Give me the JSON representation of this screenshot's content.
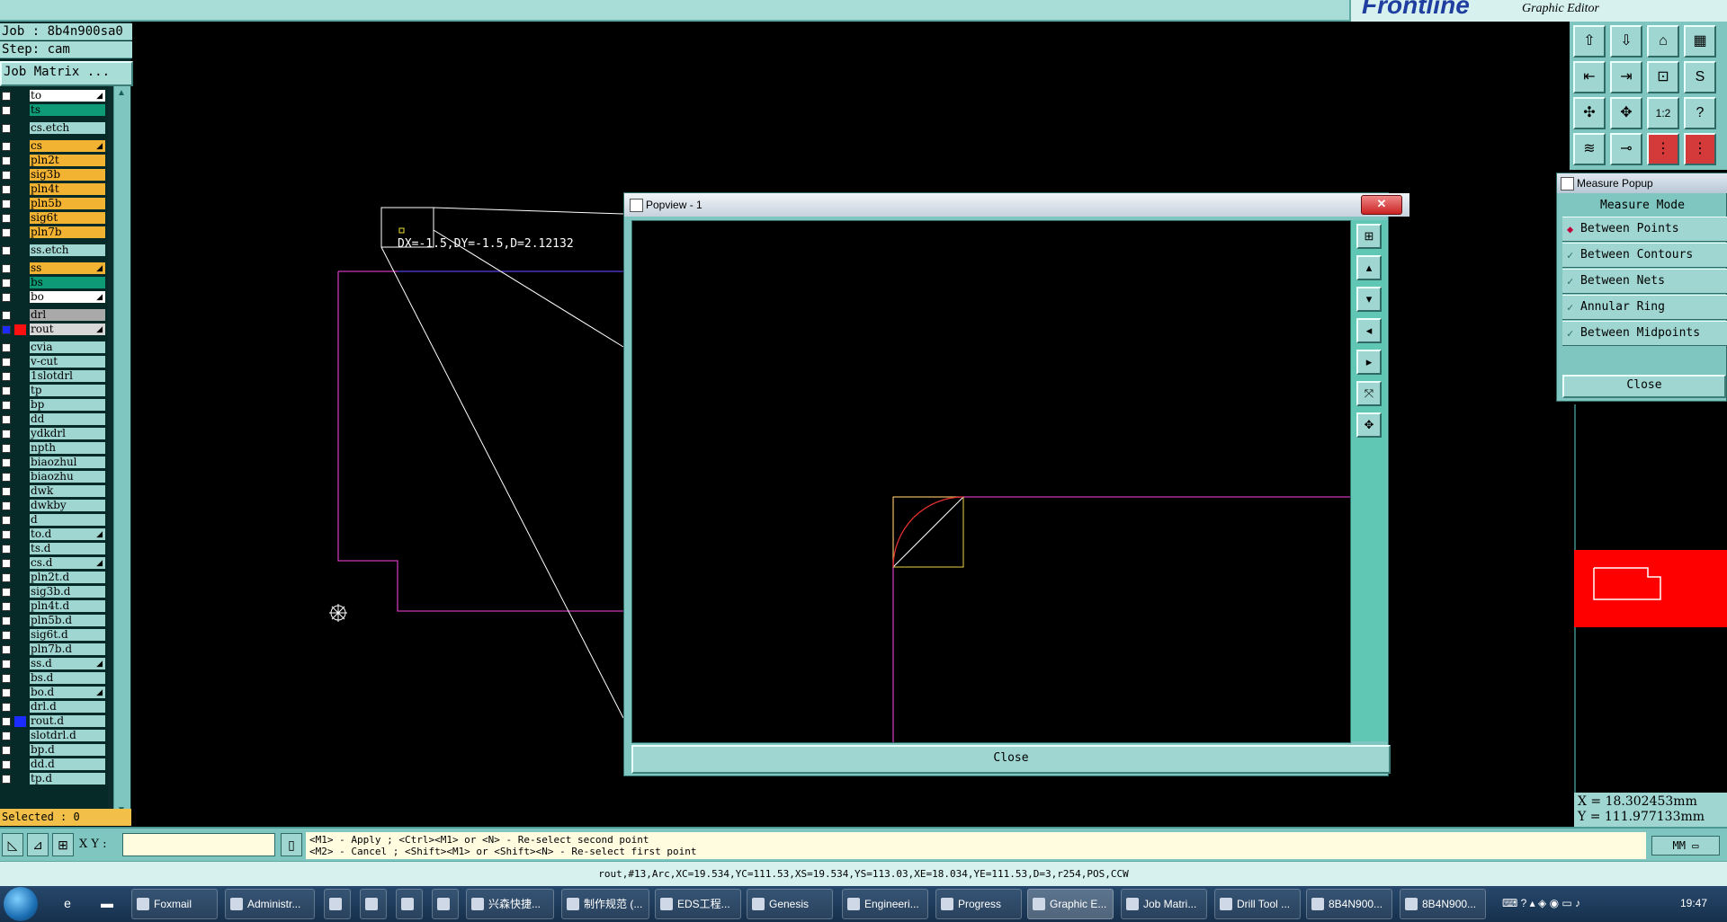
{
  "topbar": {},
  "brand": {
    "logo_text": "Frontline",
    "subtitle": "Graphic Editor"
  },
  "left_panel": {
    "job": "Job : 8b4n900sa0",
    "step": "Step: cam",
    "job_matrix_button": "Job Matrix ...",
    "selected": "Selected : 0",
    "layers": [
      {
        "name": "to",
        "color": "#ffffff",
        "arrow": true
      },
      {
        "name": "ts",
        "color": "#0e9a77",
        "arrow": false
      },
      {
        "name": "cs.etch",
        "color": "#9fd6d1",
        "arrow": false
      },
      {
        "name": "cs",
        "color": "#f2b232",
        "arrow": true
      },
      {
        "name": "pln2t",
        "color": "#f2b232",
        "arrow": false
      },
      {
        "name": "sig3b",
        "color": "#f2b232",
        "arrow": false
      },
      {
        "name": "pln4t",
        "color": "#f2b232",
        "arrow": false
      },
      {
        "name": "pln5b",
        "color": "#f2b232",
        "arrow": false
      },
      {
        "name": "sig6t",
        "color": "#f2b232",
        "arrow": false
      },
      {
        "name": "pln7b",
        "color": "#f2b232",
        "arrow": false
      },
      {
        "name": "ss.etch",
        "color": "#9fd6d1",
        "arrow": false
      },
      {
        "name": "ss",
        "color": "#f2b232",
        "arrow": true
      },
      {
        "name": "bs",
        "color": "#0e9a77",
        "arrow": false
      },
      {
        "name": "bo",
        "color": "#ffffff",
        "arrow": true
      },
      {
        "name": "drl",
        "color": "#a9a9a9",
        "arrow": false
      },
      {
        "name": "rout",
        "color": "#d8d8d8",
        "arrow": true,
        "swatch": "#ff1010",
        "checked": true
      },
      {
        "name": "cvia",
        "color": "#9fd6d1",
        "arrow": false
      },
      {
        "name": "v-cut",
        "color": "#9fd6d1",
        "arrow": false
      },
      {
        "name": "1slotdrl",
        "color": "#9fd6d1",
        "arrow": false
      },
      {
        "name": "tp",
        "color": "#9fd6d1",
        "arrow": false
      },
      {
        "name": "bp",
        "color": "#9fd6d1",
        "arrow": false
      },
      {
        "name": "dd",
        "color": "#9fd6d1",
        "arrow": false
      },
      {
        "name": "ydkdrl",
        "color": "#9fd6d1",
        "arrow": false
      },
      {
        "name": "npth",
        "color": "#9fd6d1",
        "arrow": false
      },
      {
        "name": "biaozhul",
        "color": "#9fd6d1",
        "arrow": false
      },
      {
        "name": "biaozhu",
        "color": "#9fd6d1",
        "arrow": false
      },
      {
        "name": "dwk",
        "color": "#9fd6d1",
        "arrow": false
      },
      {
        "name": "dwkby",
        "color": "#9fd6d1",
        "arrow": false
      },
      {
        "name": "d",
        "color": "#9fd6d1",
        "arrow": false
      },
      {
        "name": "to.d",
        "color": "#9fd6d1",
        "arrow": true
      },
      {
        "name": "ts.d",
        "color": "#9fd6d1",
        "arrow": false
      },
      {
        "name": "cs.d",
        "color": "#9fd6d1",
        "arrow": true
      },
      {
        "name": "pln2t.d",
        "color": "#9fd6d1",
        "arrow": false
      },
      {
        "name": "sig3b.d",
        "color": "#9fd6d1",
        "arrow": false
      },
      {
        "name": "pln4t.d",
        "color": "#9fd6d1",
        "arrow": false
      },
      {
        "name": "pln5b.d",
        "color": "#9fd6d1",
        "arrow": false
      },
      {
        "name": "sig6t.d",
        "color": "#9fd6d1",
        "arrow": false
      },
      {
        "name": "pln7b.d",
        "color": "#9fd6d1",
        "arrow": false
      },
      {
        "name": "ss.d",
        "color": "#9fd6d1",
        "arrow": true
      },
      {
        "name": "bs.d",
        "color": "#9fd6d1",
        "arrow": false
      },
      {
        "name": "bo.d",
        "color": "#9fd6d1",
        "arrow": true
      },
      {
        "name": "drl.d",
        "color": "#9fd6d1",
        "arrow": false
      },
      {
        "name": "rout.d",
        "color": "#9fd6d1",
        "arrow": false,
        "swatch": "#1a2cff"
      },
      {
        "name": "slotdrl.d",
        "color": "#9fd6d1",
        "arrow": false
      },
      {
        "name": "bp.d",
        "color": "#9fd6d1",
        "arrow": false
      },
      {
        "name": "dd.d",
        "color": "#9fd6d1",
        "arrow": false
      },
      {
        "name": "tp.d",
        "color": "#9fd6d1",
        "arrow": false
      }
    ]
  },
  "main_view": {
    "measure_text": "DX=-1.5,DY=-1.5,D=2.12132"
  },
  "popview": {
    "title": "Popview - 1",
    "close_button": "Close"
  },
  "measure_popup": {
    "title": "Measure Popup",
    "mode_label": "Measure Mode",
    "options": [
      {
        "label": "Between Points",
        "selected": true
      },
      {
        "label": "Between Contours",
        "selected": false
      },
      {
        "label": "Between Nets",
        "selected": false
      },
      {
        "label": "Annular Ring",
        "selected": false
      },
      {
        "label": "Between Midpoints",
        "selected": false
      }
    ],
    "close_button": "Close"
  },
  "coordinates": {
    "x": "X = 18.302453mm",
    "y": "Y = 111.977133mm"
  },
  "command_bar": {
    "xy_label": "X Y :",
    "xy_value": "",
    "hint_line1": "<M1> - Apply  ; <Ctrl><M1> or <N> - Re-select second point",
    "hint_line2": "<M2> - Cancel ; <Shift><M1> or <Shift><N> - Re-select first point",
    "unit": "MM"
  },
  "status_bar": {
    "text": "rout,#13,Arc,XC=19.534,YC=111.53,XS=19.534,YS=113.03,XE=18.034,YE=111.53,D=3,r254,POS,CCW"
  },
  "taskbar": {
    "items": [
      {
        "label": "Foxmail"
      },
      {
        "label": "Administr..."
      },
      {
        "label": ""
      },
      {
        "label": ""
      },
      {
        "label": ""
      },
      {
        "label": ""
      },
      {
        "label": "兴森快捷..."
      },
      {
        "label": "制作规范 (..."
      },
      {
        "label": "EDS工程..."
      },
      {
        "label": "Genesis"
      },
      {
        "label": "Engineeri..."
      },
      {
        "label": "Progress"
      },
      {
        "label": "Graphic E..."
      },
      {
        "label": "Job Matri..."
      },
      {
        "label": "Drill Tool ..."
      },
      {
        "label": "8B4N900..."
      },
      {
        "label": "8B4N900..."
      }
    ],
    "clock": "19:47"
  }
}
